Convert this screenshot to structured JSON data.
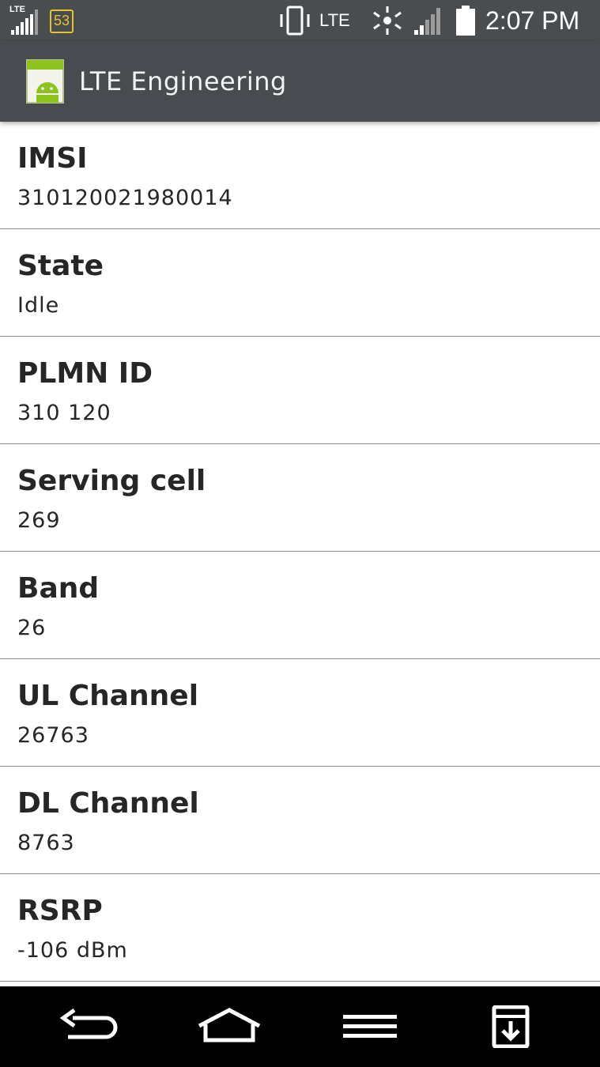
{
  "status_bar": {
    "network_type_small": "LTE",
    "notification_count": "53",
    "network_type": "LTE",
    "time": "2:07 PM",
    "icons": [
      "signal-icon",
      "notification-badge",
      "vibrate-icon",
      "sync-icon",
      "signal-icon",
      "battery-icon"
    ]
  },
  "action_bar": {
    "title": "LTE Engineering",
    "icon": "android-app-icon"
  },
  "rows": [
    {
      "label": "IMSI",
      "value": "310120021980014"
    },
    {
      "label": "State",
      "value": "Idle"
    },
    {
      "label": "PLMN ID",
      "value": "310 120"
    },
    {
      "label": "Serving cell",
      "value": "269"
    },
    {
      "label": "Band",
      "value": "26"
    },
    {
      "label": "UL Channel",
      "value": "26763"
    },
    {
      "label": "DL Channel",
      "value": "8763"
    },
    {
      "label": "RSRP",
      "value": "-106 dBm"
    }
  ],
  "nav_bar": {
    "icons": [
      "back-icon",
      "home-icon",
      "menu-icon",
      "save-icon"
    ]
  },
  "colors": {
    "status_bar_bg": "#4a4d50",
    "action_bar_bg": "#484c50",
    "badge": "#e7c12e",
    "text": "#262626",
    "divider": "#8a8a8a",
    "nav_bar_bg": "#000000"
  }
}
